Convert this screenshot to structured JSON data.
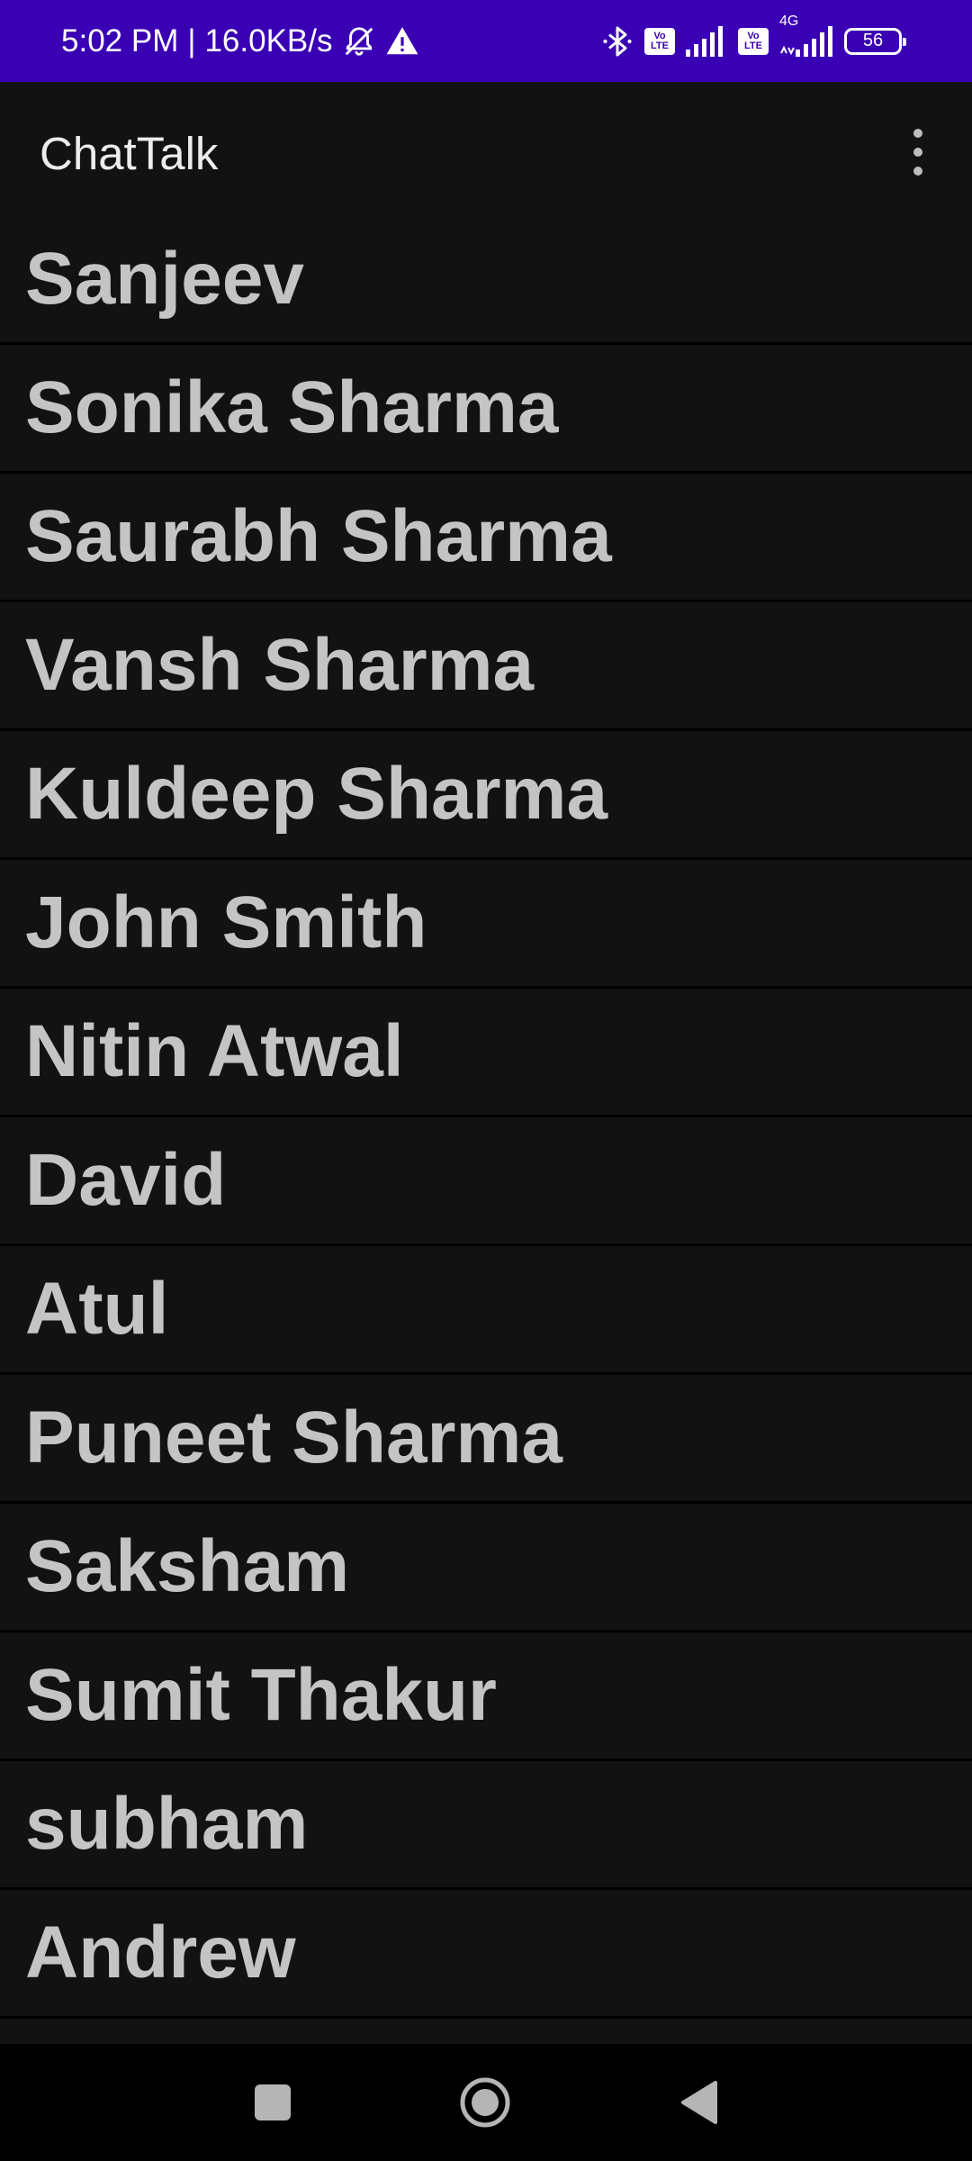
{
  "status_bar": {
    "time": "5:02 PM",
    "separator": "|",
    "network_speed": "16.0KB/s",
    "icons": [
      "bell-off-icon",
      "warning-icon",
      "bluetooth-icon",
      "volte-icon",
      "signal-icon",
      "volte-icon",
      "signal-4g-icon"
    ],
    "volte_label_1": "Vo",
    "volte_label_2": "LTE",
    "network_type": "4G",
    "battery": "56",
    "background_color": "#3a00b4"
  },
  "toolbar": {
    "title": "ChatTalk",
    "menu_icon": "more-vert-icon"
  },
  "contacts": [
    {
      "name": "Sanjeev"
    },
    {
      "name": "Sonika Sharma"
    },
    {
      "name": "Saurabh Sharma"
    },
    {
      "name": "Vansh Sharma"
    },
    {
      "name": "Kuldeep Sharma"
    },
    {
      "name": "John Smith"
    },
    {
      "name": "Nitin Atwal"
    },
    {
      "name": "David"
    },
    {
      "name": "Atul"
    },
    {
      "name": "Puneet Sharma"
    },
    {
      "name": "Saksham"
    },
    {
      "name": "Sumit Thakur"
    },
    {
      "name": "subham"
    },
    {
      "name": "Andrew"
    }
  ],
  "nav_bar": {
    "icons": [
      "recents-square-icon",
      "home-circle-icon",
      "back-triangle-icon"
    ]
  }
}
